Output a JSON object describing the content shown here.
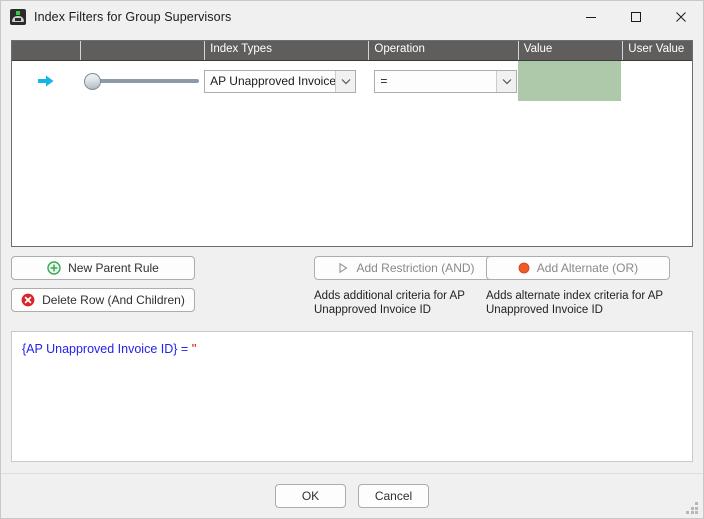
{
  "window": {
    "title": "Index Filters for Group Supervisors",
    "icon": "app-icon",
    "controls": {
      "minimize": "minimize-icon",
      "maximize": "maximize-icon",
      "close": "close-icon"
    }
  },
  "grid": {
    "columns": [
      {
        "key": "select",
        "label": ""
      },
      {
        "key": "rule",
        "label": ""
      },
      {
        "key": "index_types",
        "label": "Index Types"
      },
      {
        "key": "operation",
        "label": "Operation"
      },
      {
        "key": "value",
        "label": "Value"
      },
      {
        "key": "user_value",
        "label": "User Value"
      }
    ],
    "rows": [
      {
        "row_indicator": "row-selected-arrow-icon",
        "slider_value": 0,
        "index_type": "AP Unapproved Invoice ...",
        "operation": "=",
        "value": "",
        "user_value": ""
      }
    ]
  },
  "actions": {
    "new_parent_rule": "New Parent Rule",
    "delete_row": "Delete Row (And Children)",
    "add_restriction": "Add Restriction (AND)",
    "add_alternate": "Add Alternate (OR)",
    "add_restriction_hint": "Adds additional criteria for AP Unapproved Invoice ID",
    "add_alternate_hint": "Adds alternate index criteria for AP Unapproved Invoice ID"
  },
  "expression": {
    "field": "{AP Unapproved Invoice ID}",
    "operator": "=",
    "literal": "''"
  },
  "footer": {
    "ok": "OK",
    "cancel": "Cancel"
  },
  "colors": {
    "header_background": "#605e5c",
    "value_cell": "#aec9a9",
    "arrow_accent": "#17b4e8",
    "expression_text": "#2222ee",
    "expression_literal": "#d00000",
    "add_icon": "#3aa655",
    "delete_icon": "#d9252a",
    "alternate_icon": "#f05a28"
  }
}
